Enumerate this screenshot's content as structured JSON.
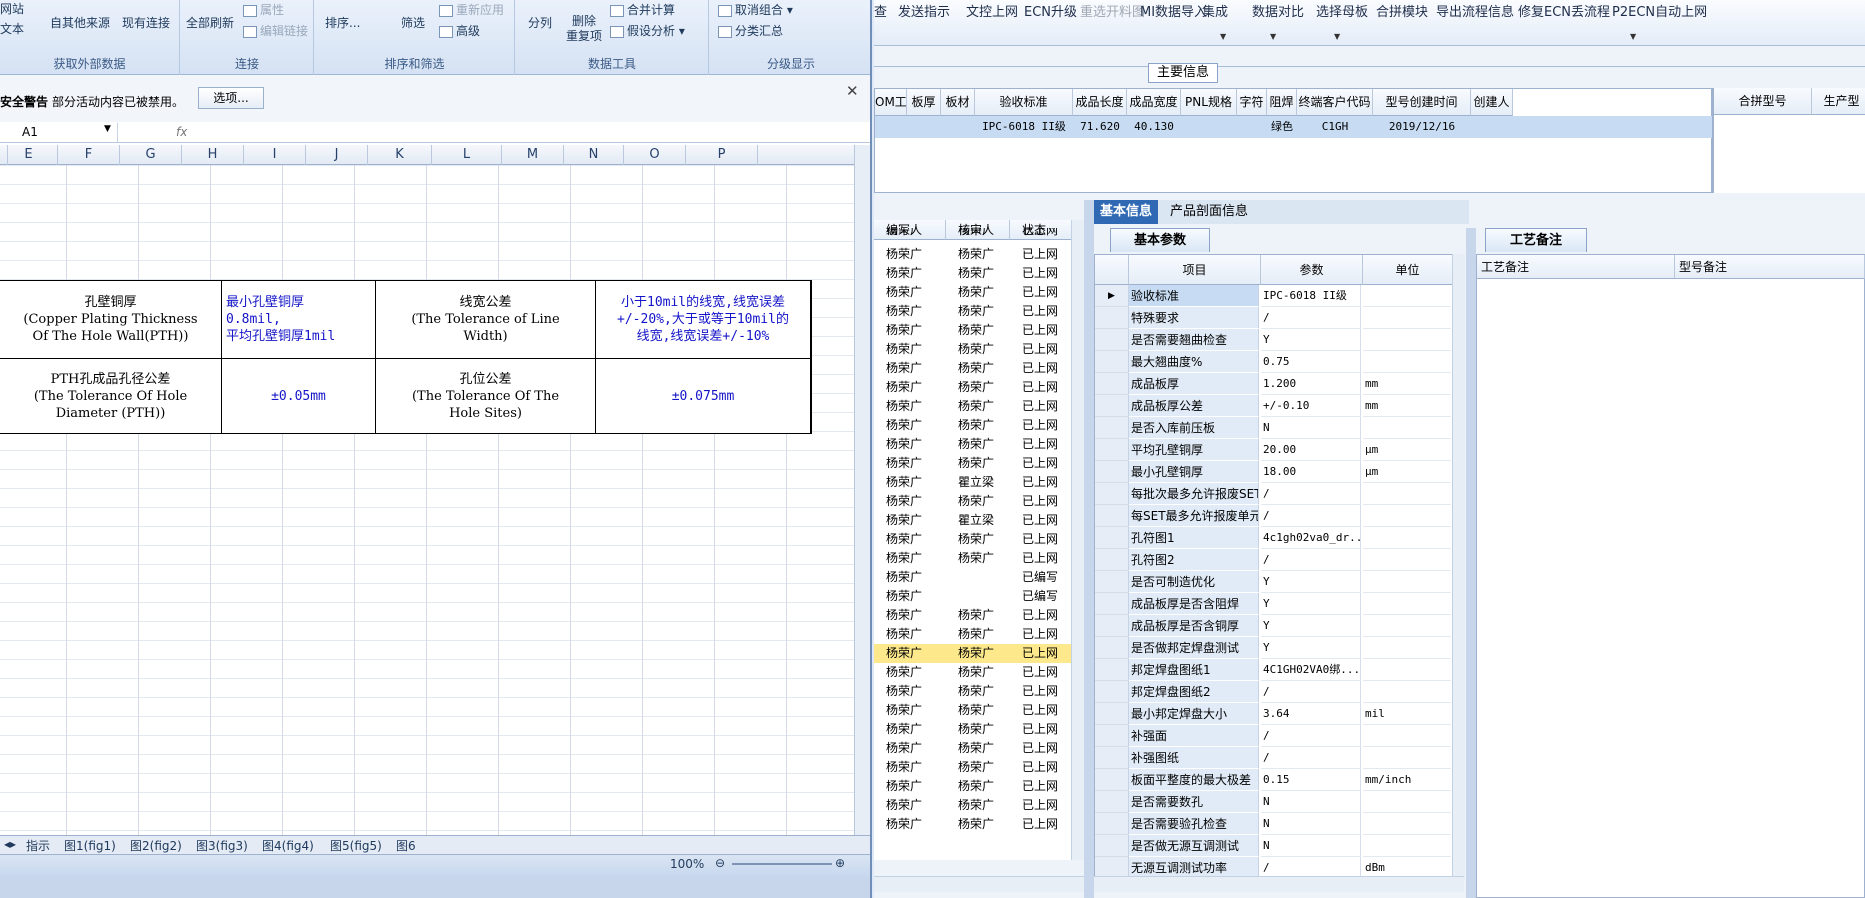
{
  "excel": {
    "ribbon": {
      "btn_website": "网站",
      "btn_text": "文本",
      "btn_other_sources": "自其他来源",
      "btn_existing_conn": "现有连接",
      "group_get_external": "获取外部数据",
      "btn_refresh_all": "全部刷新",
      "btn_properties": "属性",
      "btn_edit_links": "编辑链接",
      "group_connections": "连接",
      "btn_sort": "排序...",
      "btn_filter": "筛选",
      "btn_reapply": "重新应用",
      "btn_advanced": "高级",
      "group_sort_filter": "排序和筛选",
      "btn_split": "分列",
      "btn_remove_dup": "删除\n重复项",
      "btn_consolidate": "合并计算",
      "btn_whatif": "假设分析",
      "group_data_tools": "数据工具",
      "btn_ungroup": "取消组合",
      "btn_subtotal": "分类汇总",
      "group_outline": "分级显示"
    },
    "security": {
      "title": "安全警告",
      "message": "部分活动内容已被禁用。",
      "options_button": "选项..."
    },
    "namebox": "A1",
    "fx": "fx",
    "columns": [
      "E",
      "F",
      "G",
      "H",
      "I",
      "J",
      "K",
      "L",
      "M",
      "N",
      "O",
      "P"
    ],
    "table": {
      "r1c1": "孔壁铜厚\n(Copper Plating Thickness\nOf The Hole Wall(PTH))",
      "r1c2": "最小孔壁铜厚\n0.8mil,\n平均孔壁铜厚1mil",
      "r1c3": "线宽公差\n(The Tolerance of Line\nWidth)",
      "r1c4": "小于10mil的线宽,线宽误差\n+/-20%,大于或等于10mil的\n线宽,线宽误差+/-10%",
      "r2c1": "PTH孔成品孔径公差\n(The Tolerance Of Hole\nDiameter (PTH))",
      "r2c2": "±0.05mm",
      "r2c3": "孔位公差\n(The Tolerance Of The\nHole Sites)",
      "r2c4": "±0.075mm"
    },
    "sheet_tabs": [
      "指示",
      "图1(fig1)",
      "图2(fig2)",
      "图3(fig3)",
      "图4(fig4)",
      "图5(fig5)",
      "图6"
    ],
    "zoom": "100%"
  },
  "app": {
    "menu": [
      {
        "label": "查"
      },
      {
        "label": "发送指示"
      },
      {
        "label": "文控上网"
      },
      {
        "label": "ECN升级"
      },
      {
        "label": "重选开料图",
        "disabled": true
      },
      {
        "label": "MI数据导入"
      },
      {
        "label": "集成"
      },
      {
        "label": "数据对比"
      },
      {
        "label": "选择母板"
      },
      {
        "label": "合拼模块"
      },
      {
        "label": "导出流程信息"
      },
      {
        "label": "修复ECN丢流程"
      },
      {
        "label": "P2ECN自动上网"
      }
    ],
    "main_info_label": "主要信息",
    "main_grid": {
      "headers": [
        "OM工厂",
        "板厚",
        "板材",
        "验收标准",
        "成品长度",
        "成品宽度",
        "PNL规格",
        "字符",
        "阻焊",
        "终端客户代码",
        "型号创建时间",
        "创建人"
      ],
      "row": {
        "standard": "IPC-6018 II级",
        "length": "71.620",
        "width": "40.130",
        "solder": "绿色",
        "customer": "C1GH",
        "created": "2019/12/16"
      }
    },
    "right_grid_headers": [
      "合拼型号",
      "生产型"
    ],
    "list": {
      "headers": [
        "编写人",
        "核审人",
        "状态"
      ],
      "partial_top": {
        "writer": "杨荣广",
        "reviewer": "杨荣广",
        "status": "已上网"
      },
      "rows": [
        {
          "writer": "杨荣广",
          "reviewer": "杨荣广",
          "status": "已上网"
        },
        {
          "writer": "杨荣广",
          "reviewer": "杨荣广",
          "status": "已上网"
        },
        {
          "writer": "杨荣广",
          "reviewer": "杨荣广",
          "status": "已上网"
        },
        {
          "writer": "杨荣广",
          "reviewer": "杨荣广",
          "status": "已上网"
        },
        {
          "writer": "杨荣广",
          "reviewer": "杨荣广",
          "status": "已上网"
        },
        {
          "writer": "杨荣广",
          "reviewer": "杨荣广",
          "status": "已上网"
        },
        {
          "writer": "杨荣广",
          "reviewer": "杨荣广",
          "status": "已上网"
        },
        {
          "writer": "杨荣广",
          "reviewer": "杨荣广",
          "status": "已上网"
        },
        {
          "writer": "杨荣广",
          "reviewer": "杨荣广",
          "status": "已上网"
        },
        {
          "writer": "杨荣广",
          "reviewer": "杨荣广",
          "status": "已上网"
        },
        {
          "writer": "杨荣广",
          "reviewer": "杨荣广",
          "status": "已上网"
        },
        {
          "writer": "杨荣广",
          "reviewer": "杨荣广",
          "status": "已上网"
        },
        {
          "writer": "杨荣广",
          "reviewer": "瞿立梁",
          "status": "已上网"
        },
        {
          "writer": "杨荣广",
          "reviewer": "杨荣广",
          "status": "已上网"
        },
        {
          "writer": "杨荣广",
          "reviewer": "瞿立梁",
          "status": "已上网"
        },
        {
          "writer": "杨荣广",
          "reviewer": "杨荣广",
          "status": "已上网"
        },
        {
          "writer": "杨荣广",
          "reviewer": "杨荣广",
          "status": "已上网"
        },
        {
          "writer": "杨荣广",
          "reviewer": "",
          "status": "已编写"
        },
        {
          "writer": "杨荣广",
          "reviewer": "",
          "status": "已编写"
        },
        {
          "writer": "杨荣广",
          "reviewer": "杨荣广",
          "status": "已上网"
        },
        {
          "writer": "杨荣广",
          "reviewer": "杨荣广",
          "status": "已上网"
        },
        {
          "writer": "杨荣广",
          "reviewer": "杨荣广",
          "status": "已上网",
          "selected": true
        },
        {
          "writer": "杨荣广",
          "reviewer": "杨荣广",
          "status": "已上网"
        },
        {
          "writer": "杨荣广",
          "reviewer": "杨荣广",
          "status": "已上网"
        },
        {
          "writer": "杨荣广",
          "reviewer": "杨荣广",
          "status": "已上网"
        },
        {
          "writer": "杨荣广",
          "reviewer": "杨荣广",
          "status": "已上网"
        },
        {
          "writer": "杨荣广",
          "reviewer": "杨荣广",
          "status": "已上网"
        },
        {
          "writer": "杨荣广",
          "reviewer": "杨荣广",
          "status": "已上网"
        },
        {
          "writer": "杨荣广",
          "reviewer": "杨荣广",
          "status": "已上网"
        },
        {
          "writer": "杨荣广",
          "reviewer": "杨荣广",
          "status": "已上网"
        },
        {
          "writer": "杨荣广",
          "reviewer": "杨荣广",
          "status": "已上网"
        }
      ]
    },
    "tabs": [
      "基本信息",
      "产品剖面信息"
    ],
    "subtab": "基本参数",
    "param_headers": [
      "项目",
      "参数",
      "单位"
    ],
    "params": [
      {
        "name": "验收标准",
        "value": "IPC-6018 II级",
        "unit": "",
        "selected": true
      },
      {
        "name": "特殊要求",
        "value": "/",
        "unit": ""
      },
      {
        "name": "是否需要翘曲检查",
        "value": "Y",
        "unit": ""
      },
      {
        "name": "最大翘曲度%",
        "value": "0.75",
        "unit": ""
      },
      {
        "name": "成品板厚",
        "value": "1.200",
        "unit": "mm"
      },
      {
        "name": "成品板厚公差",
        "value": "+/-0.10",
        "unit": "mm"
      },
      {
        "name": "是否入库前压板",
        "value": "N",
        "unit": ""
      },
      {
        "name": "平均孔壁铜厚",
        "value": "20.00",
        "unit": "μm"
      },
      {
        "name": "最小孔壁铜厚",
        "value": "18.00",
        "unit": "μm"
      },
      {
        "name": "每批次最多允许报废SET",
        "value": "/",
        "unit": ""
      },
      {
        "name": "每SET最多允许报废单元",
        "value": "/",
        "unit": ""
      },
      {
        "name": "孔符图1",
        "value": "4c1gh02va0_dr...",
        "unit": ""
      },
      {
        "name": "孔符图2",
        "value": "/",
        "unit": ""
      },
      {
        "name": "是否可制造优化",
        "value": "Y",
        "unit": ""
      },
      {
        "name": "成品板厚是否含阻焊",
        "value": "Y",
        "unit": ""
      },
      {
        "name": "成品板厚是否含铜厚",
        "value": "Y",
        "unit": ""
      },
      {
        "name": "是否做邦定焊盘测试",
        "value": "Y",
        "unit": ""
      },
      {
        "name": "邦定焊盘图纸1",
        "value": "4C1GH02VA0绑...",
        "unit": ""
      },
      {
        "name": "邦定焊盘图纸2",
        "value": "/",
        "unit": ""
      },
      {
        "name": "最小邦定焊盘大小",
        "value": "3.64",
        "unit": "mil"
      },
      {
        "name": "补强面",
        "value": "/",
        "unit": ""
      },
      {
        "name": "补强图纸",
        "value": "/",
        "unit": ""
      },
      {
        "name": "板面平整度的最大极差",
        "value": "0.15",
        "unit": "mm/inch"
      },
      {
        "name": "是否需要数孔",
        "value": "N",
        "unit": ""
      },
      {
        "name": "是否需要验孔检查",
        "value": "N",
        "unit": ""
      },
      {
        "name": "是否做无源互调测试",
        "value": "N",
        "unit": ""
      },
      {
        "name": "无源互调测试功率",
        "value": "/",
        "unit": "dBm"
      }
    ],
    "notes_tab": "工艺备注",
    "notes_headers": [
      "工艺备注",
      "型号备注"
    ]
  }
}
